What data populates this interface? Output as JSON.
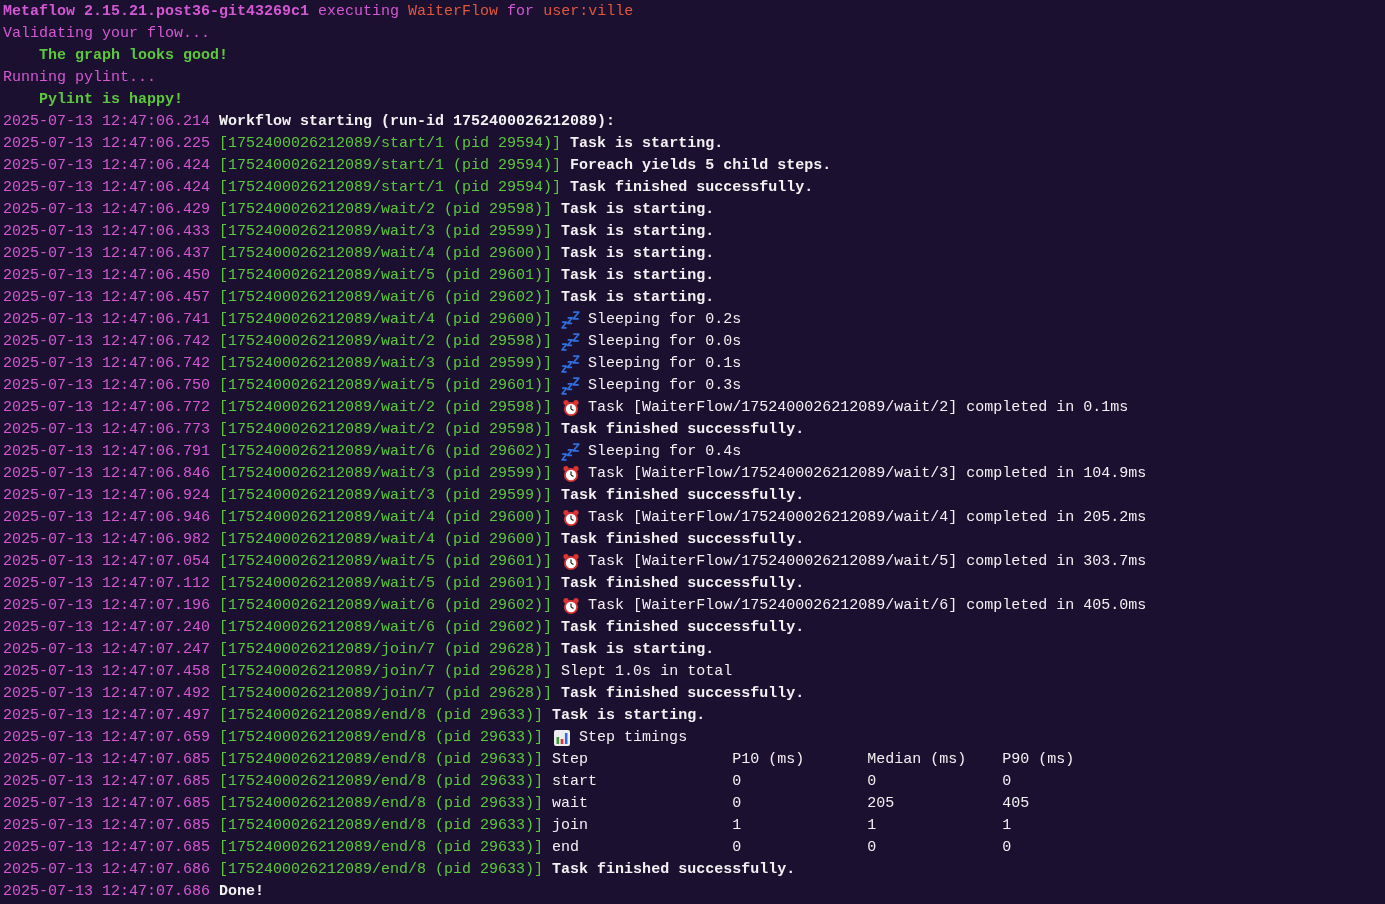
{
  "preamble": [
    {
      "indented": false,
      "segments": [
        {
          "text": "Metaflow 2.15.21.post36-git43269c1",
          "color": "#d457d4",
          "bold": true
        },
        {
          "text": " executing ",
          "color": "#d457d4",
          "bold": false
        },
        {
          "text": "WaiterFlow",
          "color": "#e0573c",
          "bold": false
        },
        {
          "text": " for ",
          "color": "#d457d4",
          "bold": false
        },
        {
          "text": "user:ville",
          "color": "#e0573c",
          "bold": false
        }
      ]
    },
    {
      "indented": false,
      "segments": [
        {
          "text": "Validating your flow...",
          "color": "#d457d4",
          "bold": false
        }
      ]
    },
    {
      "indented": true,
      "segments": [
        {
          "text": "The graph looks good!",
          "color": "#5cc83c",
          "bold": true
        }
      ]
    },
    {
      "indented": false,
      "segments": [
        {
          "text": "Running pylint...",
          "color": "#d457d4",
          "bold": false
        }
      ]
    },
    {
      "indented": true,
      "segments": [
        {
          "text": "Pylint is happy!",
          "color": "#5cc83c",
          "bold": true
        }
      ]
    }
  ],
  "log": [
    {
      "timestamp": "2025-07-13 12:47:06.214",
      "text": "Workflow starting (run-id 1752400026212089):",
      "bold": true
    },
    {
      "timestamp": "2025-07-13 12:47:06.225",
      "task": "[1752400026212089/start/1 (pid 29594)]",
      "text": "Task is starting.",
      "bold": true
    },
    {
      "timestamp": "2025-07-13 12:47:06.424",
      "task": "[1752400026212089/start/1 (pid 29594)]",
      "text": "Foreach yields 5 child steps.",
      "bold": true
    },
    {
      "timestamp": "2025-07-13 12:47:06.424",
      "task": "[1752400026212089/start/1 (pid 29594)]",
      "text": "Task finished successfully.",
      "bold": true
    },
    {
      "timestamp": "2025-07-13 12:47:06.429",
      "task": "[1752400026212089/wait/2 (pid 29598)]",
      "text": "Task is starting.",
      "bold": true
    },
    {
      "timestamp": "2025-07-13 12:47:06.433",
      "task": "[1752400026212089/wait/3 (pid 29599)]",
      "text": "Task is starting.",
      "bold": true
    },
    {
      "timestamp": "2025-07-13 12:47:06.437",
      "task": "[1752400026212089/wait/4 (pid 29600)]",
      "text": "Task is starting.",
      "bold": true
    },
    {
      "timestamp": "2025-07-13 12:47:06.450",
      "task": "[1752400026212089/wait/5 (pid 29601)]",
      "text": "Task is starting.",
      "bold": true
    },
    {
      "timestamp": "2025-07-13 12:47:06.457",
      "task": "[1752400026212089/wait/6 (pid 29602)]",
      "text": "Task is starting.",
      "bold": true
    },
    {
      "timestamp": "2025-07-13 12:47:06.741",
      "task": "[1752400026212089/wait/4 (pid 29600)]",
      "kind": "sleep",
      "text": "Sleeping for 0.2s",
      "bold": false
    },
    {
      "timestamp": "2025-07-13 12:47:06.742",
      "task": "[1752400026212089/wait/2 (pid 29598)]",
      "kind": "sleep",
      "text": "Sleeping for 0.0s",
      "bold": false
    },
    {
      "timestamp": "2025-07-13 12:47:06.742",
      "task": "[1752400026212089/wait/3 (pid 29599)]",
      "kind": "sleep",
      "text": "Sleeping for 0.1s",
      "bold": false
    },
    {
      "timestamp": "2025-07-13 12:47:06.750",
      "task": "[1752400026212089/wait/5 (pid 29601)]",
      "kind": "sleep",
      "text": "Sleeping for 0.3s",
      "bold": false
    },
    {
      "timestamp": "2025-07-13 12:47:06.772",
      "task": "[1752400026212089/wait/2 (pid 29598)]",
      "kind": "clock",
      "text": "Task [WaiterFlow/1752400026212089/wait/2] completed in 0.1ms",
      "bold": false
    },
    {
      "timestamp": "2025-07-13 12:47:06.773",
      "task": "[1752400026212089/wait/2 (pid 29598)]",
      "text": "Task finished successfully.",
      "bold": true
    },
    {
      "timestamp": "2025-07-13 12:47:06.791",
      "task": "[1752400026212089/wait/6 (pid 29602)]",
      "kind": "sleep",
      "text": "Sleeping for 0.4s",
      "bold": false
    },
    {
      "timestamp": "2025-07-13 12:47:06.846",
      "task": "[1752400026212089/wait/3 (pid 29599)]",
      "kind": "clock",
      "text": "Task [WaiterFlow/1752400026212089/wait/3] completed in 104.9ms",
      "bold": false
    },
    {
      "timestamp": "2025-07-13 12:47:06.924",
      "task": "[1752400026212089/wait/3 (pid 29599)]",
      "text": "Task finished successfully.",
      "bold": true
    },
    {
      "timestamp": "2025-07-13 12:47:06.946",
      "task": "[1752400026212089/wait/4 (pid 29600)]",
      "kind": "clock",
      "text": "Task [WaiterFlow/1752400026212089/wait/4] completed in 205.2ms",
      "bold": false
    },
    {
      "timestamp": "2025-07-13 12:47:06.982",
      "task": "[1752400026212089/wait/4 (pid 29600)]",
      "text": "Task finished successfully.",
      "bold": true
    },
    {
      "timestamp": "2025-07-13 12:47:07.054",
      "task": "[1752400026212089/wait/5 (pid 29601)]",
      "kind": "clock",
      "text": "Task [WaiterFlow/1752400026212089/wait/5] completed in 303.7ms",
      "bold": false
    },
    {
      "timestamp": "2025-07-13 12:47:07.112",
      "task": "[1752400026212089/wait/5 (pid 29601)]",
      "text": "Task finished successfully.",
      "bold": true
    },
    {
      "timestamp": "2025-07-13 12:47:07.196",
      "task": "[1752400026212089/wait/6 (pid 29602)]",
      "kind": "clock",
      "text": "Task [WaiterFlow/1752400026212089/wait/6] completed in 405.0ms",
      "bold": false
    },
    {
      "timestamp": "2025-07-13 12:47:07.240",
      "task": "[1752400026212089/wait/6 (pid 29602)]",
      "text": "Task finished successfully.",
      "bold": true
    },
    {
      "timestamp": "2025-07-13 12:47:07.247",
      "task": "[1752400026212089/join/7 (pid 29628)]",
      "text": "Task is starting.",
      "bold": true
    },
    {
      "timestamp": "2025-07-13 12:47:07.458",
      "task": "[1752400026212089/join/7 (pid 29628)]",
      "text": "Slept 1.0s in total",
      "bold": false
    },
    {
      "timestamp": "2025-07-13 12:47:07.492",
      "task": "[1752400026212089/join/7 (pid 29628)]",
      "text": "Task finished successfully.",
      "bold": true
    },
    {
      "timestamp": "2025-07-13 12:47:07.497",
      "task": "[1752400026212089/end/8 (pid 29633)]",
      "text": "Task is starting.",
      "bold": true
    },
    {
      "timestamp": "2025-07-13 12:47:07.659",
      "task": "[1752400026212089/end/8 (pid 29633)]",
      "kind": "chart",
      "text": "Step timings",
      "bold": false
    },
    {
      "timestamp": "2025-07-13 12:47:07.685",
      "task": "[1752400026212089/end/8 (pid 29633)]",
      "cells": [
        "Step",
        "P10 (ms)",
        "Median (ms)",
        "P90 (ms)"
      ]
    },
    {
      "timestamp": "2025-07-13 12:47:07.685",
      "task": "[1752400026212089/end/8 (pid 29633)]",
      "cells": [
        "start",
        "0",
        "0",
        "0"
      ]
    },
    {
      "timestamp": "2025-07-13 12:47:07.685",
      "task": "[1752400026212089/end/8 (pid 29633)]",
      "cells": [
        "wait",
        "0",
        "205",
        "405"
      ]
    },
    {
      "timestamp": "2025-07-13 12:47:07.685",
      "task": "[1752400026212089/end/8 (pid 29633)]",
      "cells": [
        "join",
        "1",
        "1",
        "1"
      ]
    },
    {
      "timestamp": "2025-07-13 12:47:07.685",
      "task": "[1752400026212089/end/8 (pid 29633)]",
      "cells": [
        "end",
        "0",
        "0",
        "0"
      ]
    },
    {
      "timestamp": "2025-07-13 12:47:07.686",
      "task": "[1752400026212089/end/8 (pid 29633)]",
      "text": "Task finished successfully.",
      "bold": true
    },
    {
      "timestamp": "2025-07-13 12:47:07.686",
      "text": "Done!",
      "bold": true
    }
  ]
}
